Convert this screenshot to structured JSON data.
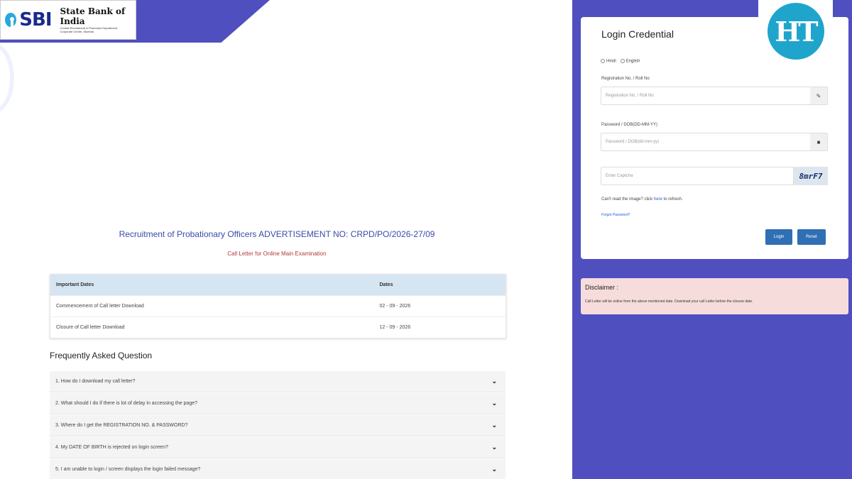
{
  "logo": {
    "sbi_text": "SBI",
    "bank_name": "State Bank of India",
    "dept_line1": "Central Recruitment & Promotion Department",
    "dept_line2": "Corporate Centre, Mumbai"
  },
  "main": {
    "advertisement_title": "Recruitment of Probationary Officers ADVERTISEMENT NO: CRPD/PO/2026-27/09",
    "subtitle": "Call Letter for Online Main Examination",
    "dates_table": {
      "headers": [
        "Important Dates",
        "Dates"
      ],
      "rows": [
        [
          "Commencement of Call letter Download",
          "02 - 09 - 2026"
        ],
        [
          "Closure of Call letter Download",
          "12 - 09 - 2026"
        ]
      ]
    },
    "faq_heading": "Frequently Asked Question",
    "faq": [
      "1. How do I download my call letter?",
      "2. What should I do if there is lot of delay in accessing the page?",
      "3. Where do I get the REGISTRATION NO. & PASSWORD?",
      "4. My DATE OF BIRTH is rejected on login screen?",
      "5. I am unable to login / screen displays the login failed message?"
    ]
  },
  "login": {
    "title": "Login Credential",
    "lang_hindi": "Hindi",
    "lang_english": "English",
    "reg_label": "Registration No. / Roll No",
    "reg_placeholder": "Registration No. / Roll No",
    "pwd_label": "Password / DOB(DD-MM-YY)",
    "pwd_placeholder": "Password / DOB(dd-mm-yy)",
    "captcha_placeholder": "Enter Captcha",
    "captcha_text": "8mrF7",
    "refresh_prefix": "Can't read the image? click ",
    "refresh_link": "here",
    "refresh_suffix": " to refresh.",
    "forgot": "Forgot Password?",
    "login_button": "Login",
    "reset_button": "Reset"
  },
  "watermark": {
    "ht": "HT"
  },
  "disclaimer": {
    "title": "Disclaimer :",
    "text": "Call Letter will be online from the above mentioned date. Download your call Letter before the closure date."
  },
  "colors": {
    "accent": "#4f4fbf",
    "button": "#2f6fb4",
    "disclaimer_bg": "#f7dcdc"
  },
  "icons": {
    "reg_field": "pencil-icon",
    "pwd_field": "lock-icon",
    "faq_toggle": "chevron-down-icon"
  }
}
